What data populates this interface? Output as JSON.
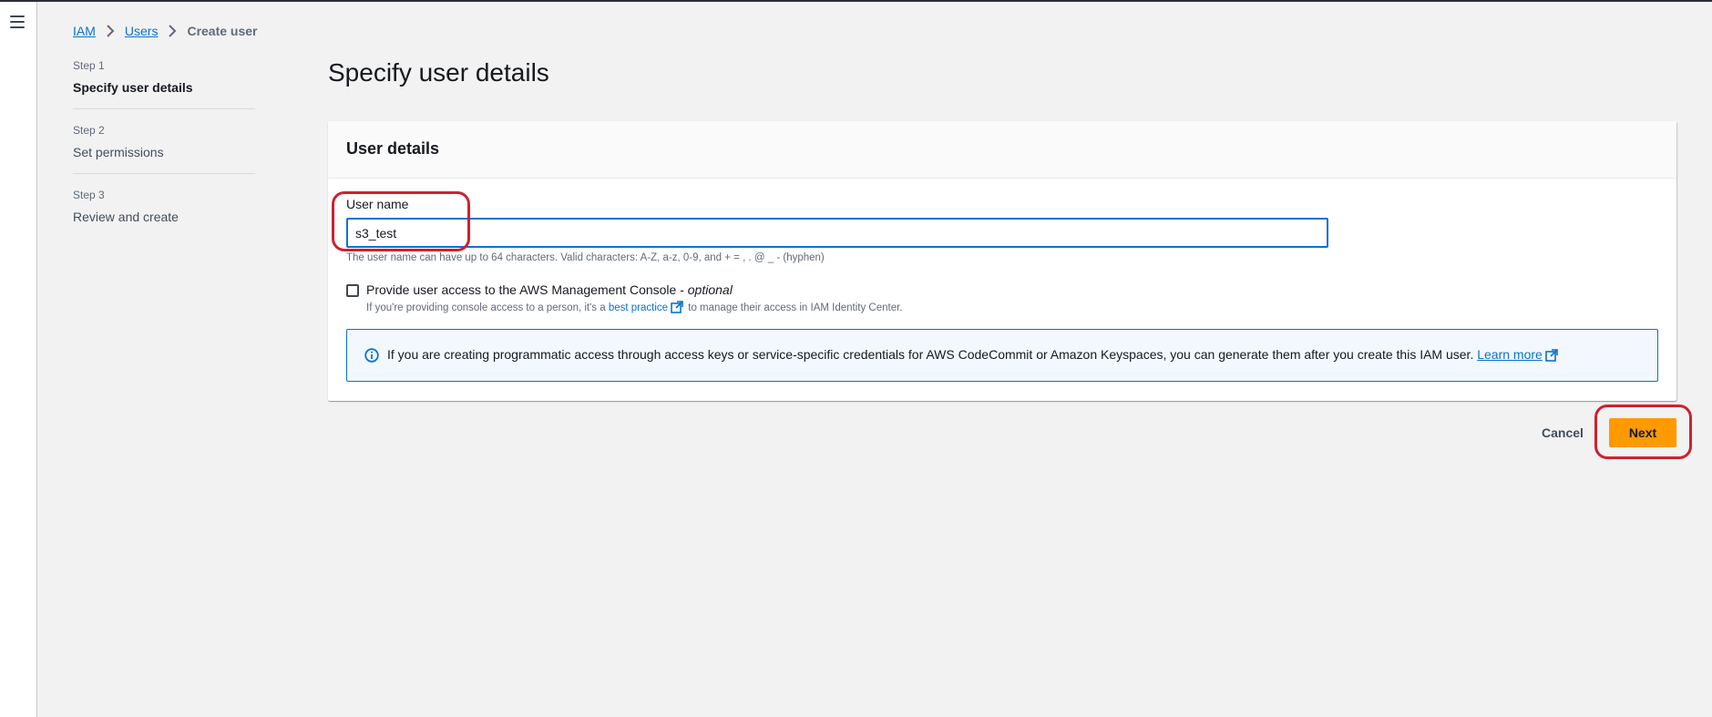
{
  "breadcrumb": {
    "items": [
      "IAM",
      "Users",
      "Create user"
    ]
  },
  "steps": [
    {
      "num": "Step 1",
      "label": "Specify user details",
      "active": true
    },
    {
      "num": "Step 2",
      "label": "Set permissions",
      "active": false
    },
    {
      "num": "Step 3",
      "label": "Review and create",
      "active": false
    }
  ],
  "page_title": "Specify user details",
  "user_details": {
    "header": "User details",
    "username_label": "User name",
    "username_value": "s3_test",
    "username_hint": "The user name can have up to 64 characters. Valid characters: A-Z, a-z, 0-9, and + = , . @ _ - (hyphen)",
    "console_access_label": "Provide user access to the AWS Management Console -",
    "console_access_optional": "optional",
    "console_access_checked": false,
    "console_desc_before": "If you're providing console access to a person, it's a",
    "console_desc_link": "best practice",
    "console_desc_after": "to manage their access in IAM Identity Center.",
    "info_text": "If you are creating programmatic access through access keys or service-specific credentials for AWS CodeCommit or Amazon Keyspaces, you can generate them after you create this IAM user.",
    "info_link": "Learn more"
  },
  "actions": {
    "cancel": "Cancel",
    "next": "Next"
  },
  "colors": {
    "primary_button": "#ff9900",
    "link": "#0972d3",
    "annotation": "#d0202e"
  }
}
